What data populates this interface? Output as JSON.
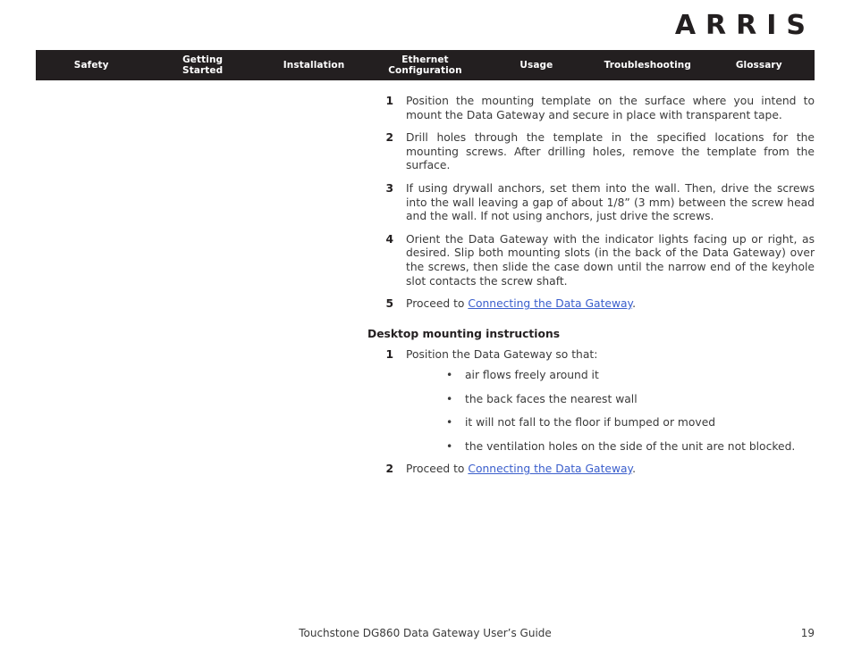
{
  "brand": {
    "logo_text": "ARRIS"
  },
  "nav": {
    "items": [
      {
        "label": "Safety"
      },
      {
        "label": "Getting\nStarted"
      },
      {
        "label": "Installation"
      },
      {
        "label": "Ethernet\nConfiguration"
      },
      {
        "label": "Usage"
      },
      {
        "label": "Troubleshooting"
      },
      {
        "label": "Glossary"
      }
    ]
  },
  "main": {
    "wall_steps": [
      {
        "number": "1",
        "text": "Position the mounting template on the surface where you intend to mount the Data Gateway and secure in place with transparent tape."
      },
      {
        "number": "2",
        "text": "Drill holes through the template in the specified locations for the mounting screws. After drilling holes, remove the template from the surface."
      },
      {
        "number": "3",
        "text": "If using drywall anchors, set them into the wall. Then, drive the screws into the wall leaving a gap of about 1/8” (3 mm) between the screw head and the wall. If not using anchors, just drive the screws."
      },
      {
        "number": "4",
        "text": "Orient the Data Gateway with the indicator lights facing up or right, as desired. Slip both mounting slots (in the back of the Data Gateway) over the screws, then slide the case down until the narrow end of the keyhole slot contacts the screw shaft."
      }
    ],
    "wall_final_step": {
      "number": "5",
      "prefix": "Proceed to ",
      "link_text": "Connecting the Data Gateway",
      "suffix": "."
    },
    "desktop_heading": "Desktop mounting instructions",
    "desktop_step_1": {
      "number": "1",
      "text": "Position the Data Gateway so that:"
    },
    "desktop_bullets": [
      {
        "marker": "•",
        "text": "air flows freely around it"
      },
      {
        "marker": "•",
        "text": "the back faces the nearest wall"
      },
      {
        "marker": "•",
        "text": "it will not fall to the floor if bumped or moved"
      },
      {
        "marker": "•",
        "text": "the ventilation holes on the side of the unit are not blocked."
      }
    ],
    "desktop_final_step": {
      "number": "2",
      "prefix": "Proceed to ",
      "link_text": "Connecting the Data Gateway",
      "suffix": "."
    }
  },
  "footer": {
    "title": "Touchstone DG860 Data Gateway User’s Guide",
    "page_number": "19"
  },
  "colors": {
    "nav_background": "#231f20",
    "link": "#3a5ecc",
    "body_text": "#3a3a3a"
  }
}
